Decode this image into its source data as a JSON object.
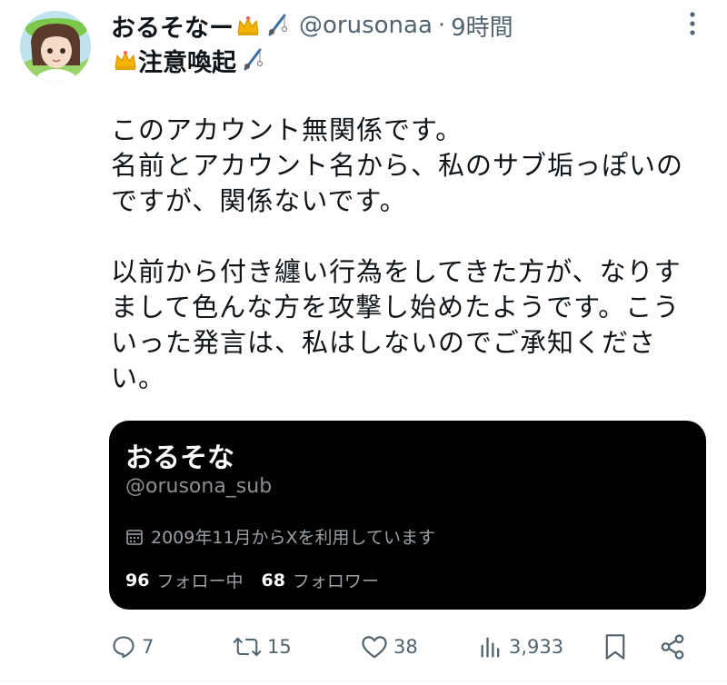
{
  "post": {
    "author": {
      "display_name": "おるそなー",
      "handle": "@orusonaa",
      "name_line2": "注意喚起",
      "avatar_icon": "avatar-anime-girl"
    },
    "separator": "·",
    "timestamp": "9時間",
    "body": {
      "paragraph1": [
        "このアカウント無関係です。",
        "名前とアカウント名から、私のサブ垢っぽいの",
        "ですが、関係ないです。"
      ],
      "paragraph2": [
        "以前から付き纏い行為をしてきた方が、なりす",
        "まして色んな方を攻撃し始めたようです。こう",
        "いった発言は、私はしないのでご承知くださ",
        "い。"
      ]
    },
    "embedded_card": {
      "name": "おるそな",
      "handle": "@orusona_sub",
      "joined": "2009年11月からXを利用しています",
      "following_count": "96",
      "following_label": "フォロー中",
      "followers_count": "68",
      "followers_label": "フォロワー"
    },
    "actions": {
      "replies": "7",
      "reposts": "15",
      "likes": "38",
      "views": "3,933"
    },
    "colors": {
      "text": "#0f1419",
      "secondary": "#536471",
      "card_bg": "#000000"
    }
  }
}
